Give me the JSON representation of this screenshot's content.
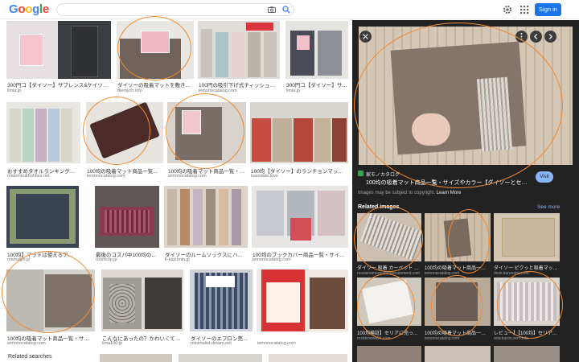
{
  "header": {
    "logo_letters": [
      "G",
      "o",
      "o",
      "g",
      "l",
      "e"
    ],
    "logo_colors": [
      "#4285f4",
      "#ea4335",
      "#fbbc05",
      "#4285f4",
      "#34a853",
      "#ea4335"
    ],
    "search_value": "",
    "sign_in_label": "Sign in"
  },
  "results": [
    {
      "title": "300円コ【ダイソー】サブレンス&ケイツをご紹介♪",
      "source": "limia.jp"
    },
    {
      "title": "ダイソーの吸着マットを敷き詰めた部屋...",
      "source": "diemych.info"
    },
    {
      "title": "100円の吸引下げ式ティッシュボックス...",
      "source": "iemonocatalog.com"
    },
    {
      "title": "300円コ【ダイソー】サブレンス&ケイ...",
      "source": "limia.jp"
    },
    {
      "title": "おすすめタオルランキング】100均...",
      "source": "matomeukhohbsx.net"
    },
    {
      "title": "100均の吸着マット商品一覧・サイズ...",
      "source": "iemonocatalog.com"
    },
    {
      "title": "100均の吸着マット商品一覧・サイズ...",
      "source": "iemonocatalog.com"
    },
    {
      "title": "100均【ダイソー】のランチョンマット・ラン...",
      "source": "kasodate.love"
    },
    {
      "title": "100均】マットは使えるアイテムがすぐ...",
      "source": "mamagirl.jp"
    },
    {
      "title": "最後のコスパ中100均の吸着マット...",
      "source": "roomclip.jp"
    },
    {
      "title": "ダイソーのルームソックスにハイソック...",
      "source": "k-kazumin.jp"
    },
    {
      "title": "100均のブックカバー商品一覧・サイズ・本...",
      "source": "iemonocatalog.com"
    },
    {
      "title": "100均の吸着マット商品一覧・サイズや色...",
      "source": "iemonocatalog.com"
    },
    {
      "title": "こんなにあったの？かわいくて実用的...",
      "source": "lima100.jp"
    },
    {
      "title": "ダイソーのエプロン売り場は...",
      "source": "minimalist.dream.net"
    },
    {
      "title": "",
      "source": "iemonocatalog.com"
    }
  ],
  "related_searches_label": "Related searches",
  "panel": {
    "site_name": "家モノカタログ",
    "title": "100均の吸着マット商品一覧・サイズやカラー【ダイソーとセリアで比100...",
    "visit_label": "Visit",
    "copyright_text": "Images may be subject to copyright.",
    "learn_more_label": "Learn More",
    "related_images_label": "Related images",
    "see_more_label": "See more"
  },
  "related": [
    {
      "title": "ダイソー 吸着 カーペット 100...",
      "source": "russianamericanentertainment.com"
    },
    {
      "title": "100均の吸着マット商品一覧・サイズ...",
      "source": "iemonocatalog.com"
    },
    {
      "title": "ダイソー ピクッと吸着マット】を...",
      "source": "desk.kuronobu.com"
    },
    {
      "title": "100均検証】セリアに売ってた...",
      "source": "rockinnews24.com"
    },
    {
      "title": "100均の吸着マット商品一覧・サイズ...",
      "source": "iemonocatalog.com"
    },
    {
      "title": "レビュー】【100均】セリア...",
      "source": "reta.kuron.zero.info"
    }
  ],
  "colors": {
    "accent": "#1a73e8",
    "annotation": "#f28a2f",
    "panel_bg": "#222222"
  },
  "icons": [
    "camera-icon",
    "search-icon",
    "gear-icon",
    "apps-icon",
    "close-icon",
    "more-icon",
    "chevron-left-icon",
    "chevron-right-icon",
    "site-favicon"
  ]
}
